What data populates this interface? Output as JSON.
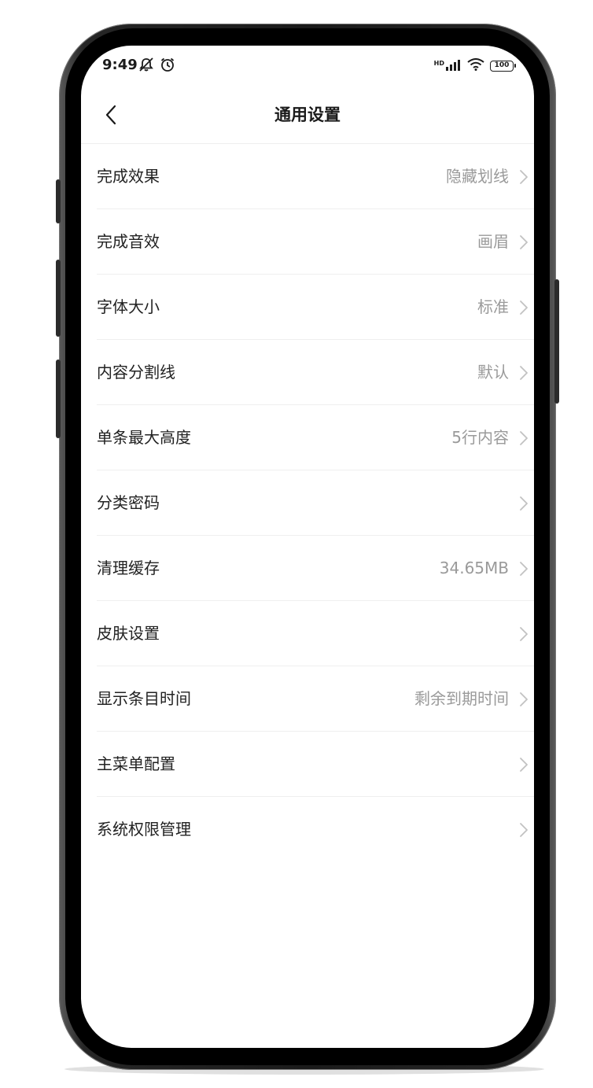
{
  "status_bar": {
    "time": "9:49",
    "battery": "100",
    "network_label": "HD",
    "icons": [
      "mute-icon",
      "alarm-icon",
      "signal-icon",
      "wifi-icon",
      "battery-icon"
    ]
  },
  "header": {
    "title": "通用设置",
    "back_icon": "chevron-left-icon"
  },
  "settings": {
    "items": [
      {
        "label": "完成效果",
        "value": "隐藏划线"
      },
      {
        "label": "完成音效",
        "value": "画眉"
      },
      {
        "label": "字体大小",
        "value": "标准"
      },
      {
        "label": "内容分割线",
        "value": "默认"
      },
      {
        "label": "单条最大高度",
        "value": "5行内容"
      },
      {
        "label": "分类密码",
        "value": ""
      },
      {
        "label": "清理缓存",
        "value": "34.65MB"
      },
      {
        "label": "皮肤设置",
        "value": ""
      },
      {
        "label": "显示条目时间",
        "value": "剩余到期时间"
      },
      {
        "label": "主菜单配置",
        "value": ""
      },
      {
        "label": "系统权限管理",
        "value": ""
      }
    ]
  },
  "colors": {
    "label": "#222222",
    "value": "#9a9a9a",
    "chevron": "#c2c2c2",
    "divider": "#efefef"
  }
}
